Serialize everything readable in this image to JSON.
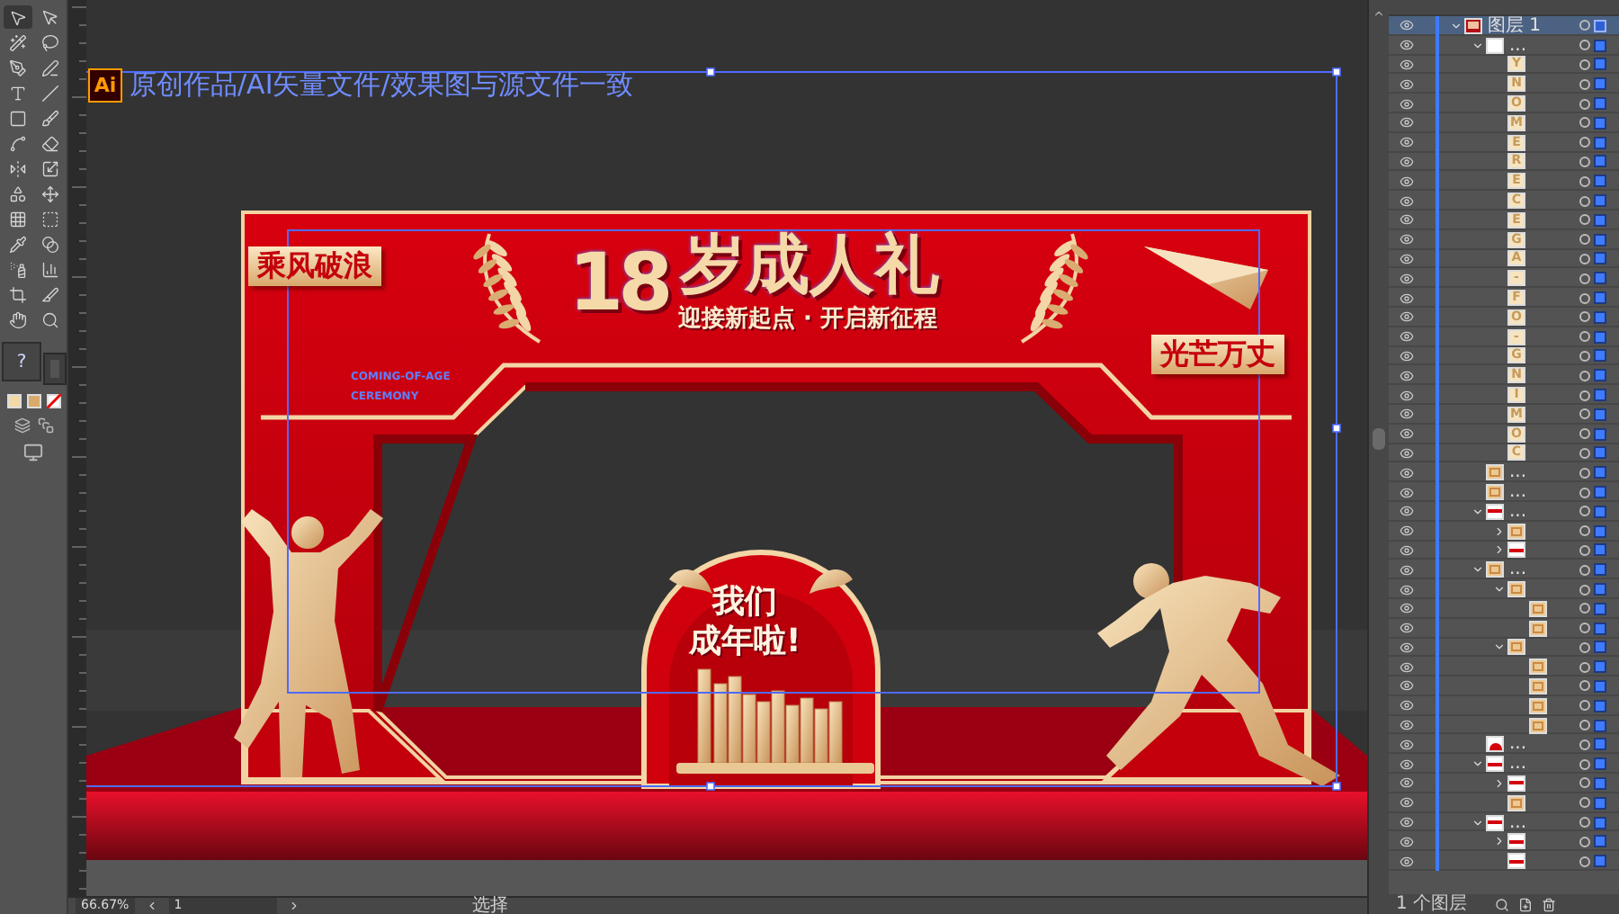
{
  "document_note": {
    "logo": "Ai",
    "text": "原创作品/AI矢量文件/效果图与源文件一致"
  },
  "artwork": {
    "tag_left": "乘风破浪",
    "title_number": "18",
    "title": "岁成人礼",
    "subtitle": "迎接新起点 · 开启新征程",
    "tag_right": "光芒万丈",
    "english_lines": [
      "COMING-OF-AGE",
      "CEREMONY"
    ],
    "badge_lines": [
      "我们",
      "成年啦!"
    ]
  },
  "toolbar": {
    "fill_box": "?"
  },
  "layers": [
    {
      "label": "图层 1",
      "kind": "layer",
      "selected": true,
      "expanded": true,
      "children": [
        {
          "label": "...",
          "kind": "group",
          "selected": false,
          "expanded": true,
          "children": [
            {
              "kind": "letter",
              "glyph": "Y",
              "selected": false
            },
            {
              "kind": "letter",
              "glyph": "N",
              "selected": false
            },
            {
              "kind": "letter",
              "glyph": "O",
              "selected": false
            },
            {
              "kind": "letter",
              "glyph": "M",
              "selected": false
            },
            {
              "kind": "letter",
              "glyph": "E",
              "selected": false
            },
            {
              "kind": "letter",
              "glyph": "R",
              "selected": false
            },
            {
              "kind": "letter",
              "glyph": "E",
              "selected": false
            },
            {
              "kind": "letter",
              "glyph": "C",
              "selected": false
            },
            {
              "kind": "letter",
              "glyph": "E",
              "selected": false
            },
            {
              "kind": "letter",
              "glyph": "G",
              "selected": false
            },
            {
              "kind": "letter",
              "glyph": "A",
              "selected": false
            },
            {
              "kind": "letter",
              "glyph": "-",
              "selected": false
            },
            {
              "kind": "letter",
              "glyph": "F",
              "selected": false
            },
            {
              "kind": "letter",
              "glyph": "O",
              "selected": false
            },
            {
              "kind": "letter",
              "glyph": "-",
              "selected": false
            },
            {
              "kind": "letter",
              "glyph": "G",
              "selected": false
            },
            {
              "kind": "letter",
              "glyph": "N",
              "selected": false
            },
            {
              "kind": "letter",
              "glyph": "I",
              "selected": false
            },
            {
              "kind": "letter",
              "glyph": "M",
              "selected": false
            },
            {
              "kind": "letter",
              "glyph": "O",
              "selected": false
            },
            {
              "kind": "letter",
              "glyph": "C",
              "selected": false
            }
          ]
        },
        {
          "label": "...",
          "kind": "art",
          "selected": false
        },
        {
          "label": "...",
          "kind": "art",
          "selected": false
        },
        {
          "label": "...",
          "kind": "band",
          "selected": false,
          "expanded": true,
          "children": [
            {
              "kind": "art",
              "selected": false,
              "expanded": false
            },
            {
              "kind": "band",
              "selected": false,
              "expanded": false
            }
          ]
        },
        {
          "label": "...",
          "kind": "art",
          "selected": false,
          "expanded": true,
          "children": [
            {
              "kind": "art",
              "selected": false,
              "expanded": true,
              "children": [
                {
                  "kind": "art",
                  "selected": false
                },
                {
                  "kind": "art",
                  "selected": false
                }
              ]
            },
            {
              "kind": "art",
              "selected": false,
              "expanded": true,
              "children": [
                {
                  "kind": "art",
                  "selected": false
                },
                {
                  "kind": "art",
                  "selected": false
                },
                {
                  "kind": "art",
                  "selected": false
                },
                {
                  "kind": "art",
                  "selected": false
                }
              ]
            }
          ]
        },
        {
          "label": "...",
          "kind": "dome",
          "selected": false
        },
        {
          "label": "...",
          "kind": "band",
          "selected": false,
          "expanded": true,
          "children": [
            {
              "kind": "band",
              "selected": false,
              "expanded": false
            },
            {
              "kind": "art",
              "selected": false
            }
          ]
        },
        {
          "label": "...",
          "kind": "band",
          "selected": false,
          "expanded": true,
          "children": [
            {
              "kind": "band",
              "selected": false,
              "expanded": false
            },
            {
              "kind": "band",
              "selected": false
            }
          ]
        }
      ]
    }
  ],
  "layers_footer": "1 个图层",
  "status_bar": {
    "zoom": "66.67%",
    "artboard": "1",
    "tool": "选择"
  }
}
